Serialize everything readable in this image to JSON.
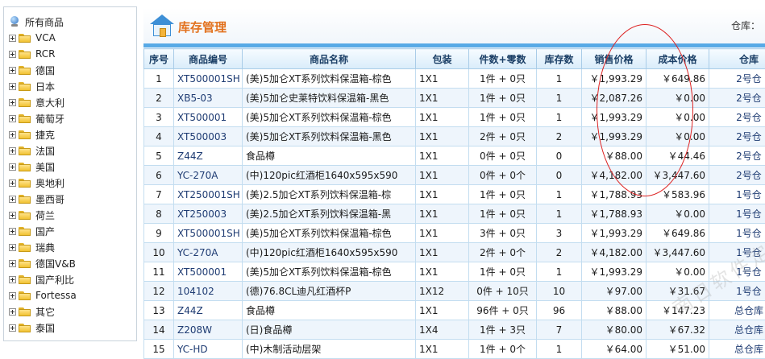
{
  "tree": {
    "root_label": "所有商品",
    "items": [
      "VCA",
      "RCR",
      "德国",
      "日本",
      "意大利",
      "葡萄牙",
      "捷克",
      "法国",
      "美国",
      "奥地利",
      "墨西哥",
      "荷兰",
      "国产",
      "瑞典",
      "德国V&B",
      "国产利比",
      "Fortessa",
      "其它",
      "泰国"
    ]
  },
  "header": {
    "title": "库存管理",
    "warehouse_label": "仓库："
  },
  "table": {
    "columns": [
      "序号",
      "商品编号",
      "商品名称",
      "包装",
      "件数+零数",
      "库存数",
      "销售价格",
      "成本价格",
      "仓库"
    ],
    "rows": [
      [
        "1",
        "XT500001SH",
        "(美)5加仑XT系列饮料保温箱-棕色",
        "1X1",
        "1件 + 0只",
        "1",
        "￥1,993.29",
        "￥649.86",
        "2号仓"
      ],
      [
        "2",
        "XB5-03",
        "(美)5加仑史莱特饮料保温箱-黑色",
        "1X1",
        "1件 + 0只",
        "1",
        "￥2,087.26",
        "￥0.00",
        "2号仓"
      ],
      [
        "3",
        "XT500001",
        "(美)5加仑XT系列饮料保温箱-棕色",
        "1X1",
        "1件 + 0只",
        "1",
        "￥1,993.29",
        "￥0.00",
        "2号仓"
      ],
      [
        "4",
        "XT500003",
        "(美)5加仑XT系列饮料保温箱-黑色",
        "1X1",
        "2件 + 0只",
        "2",
        "￥1,993.29",
        "￥0.00",
        "2号仓"
      ],
      [
        "5",
        "Z44Z",
        "食品樽",
        "1X1",
        "0件 + 0只",
        "0",
        "￥88.00",
        "￥44.46",
        "2号仓"
      ],
      [
        "6",
        "YC-270A",
        "(中)120pic红酒柜1640x595x590",
        "1X1",
        "0件 + 0个",
        "0",
        "￥4,182.00",
        "￥3,447.60",
        "2号仓"
      ],
      [
        "7",
        "XT250001SH",
        "(美)2.5加仑XT系列饮料保温箱-棕",
        "1X1",
        "1件 + 0只",
        "1",
        "￥1,788.93",
        "￥583.96",
        "1号仓"
      ],
      [
        "8",
        "XT250003",
        "(美)2.5加仑XT系列饮料保温箱-黑",
        "1X1",
        "1件 + 0只",
        "1",
        "￥1,788.93",
        "￥0.00",
        "1号仓"
      ],
      [
        "9",
        "XT500001SH",
        "(美)5加仑XT系列饮料保温箱-棕色",
        "1X1",
        "3件 + 0只",
        "3",
        "￥1,993.29",
        "￥649.86",
        "1号仓"
      ],
      [
        "10",
        "YC-270A",
        "(中)120pic红酒柜1640x595x590",
        "1X1",
        "2件 + 0个",
        "2",
        "￥4,182.00",
        "￥3,447.60",
        "1号仓"
      ],
      [
        "11",
        "XT500001",
        "(美)5加仑XT系列饮料保温箱-棕色",
        "1X1",
        "1件 + 0只",
        "1",
        "￥1,993.29",
        "￥0.00",
        "1号仓"
      ],
      [
        "12",
        "104102",
        "(德)76.8CL迪凡红酒杯P",
        "1X12",
        "0件 + 10只",
        "10",
        "￥97.00",
        "￥31.67",
        "1号仓"
      ],
      [
        "13",
        "Z44Z",
        "食品樽",
        "1X1",
        "96件 + 0只",
        "96",
        "￥88.00",
        "￥147.23",
        "总仓库"
      ],
      [
        "14",
        "Z208W",
        "(日)食品樽",
        "1X4",
        "1件 + 3只",
        "7",
        "￥80.00",
        "￥67.32",
        "总仓库"
      ],
      [
        "15",
        "YC-HD",
        "(中)木制活动层架",
        "1X1",
        "1件 + 0个",
        "1",
        "￥64.00",
        "￥51.00",
        "总仓库"
      ]
    ]
  },
  "watermark": "南日软件定制开发"
}
